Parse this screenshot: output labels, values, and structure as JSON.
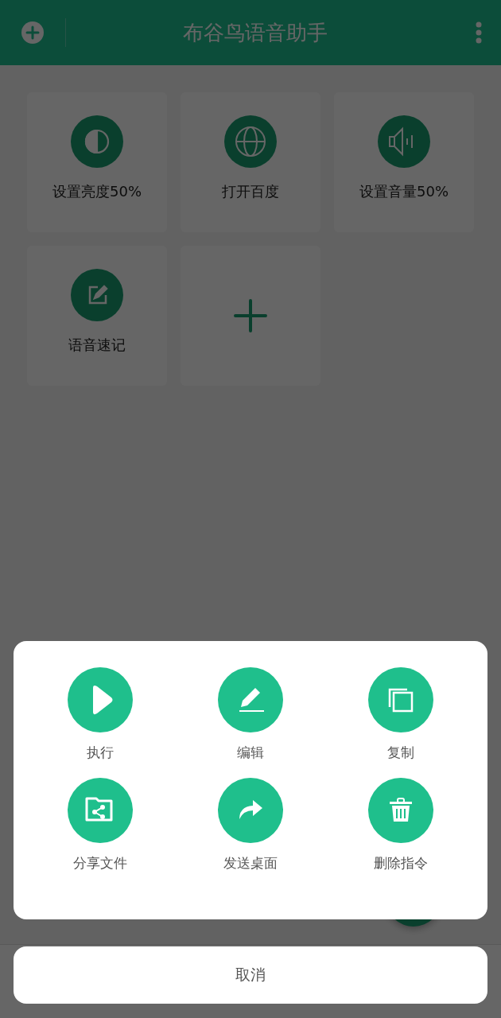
{
  "app_bar": {
    "title": "布谷鸟语音助手"
  },
  "commands": [
    {
      "kind": "command",
      "label": "设置亮度50%"
    },
    {
      "kind": "command",
      "label": "打开百度"
    },
    {
      "kind": "command",
      "label": "设置音量50%"
    },
    {
      "kind": "command",
      "label": "语音速记"
    },
    {
      "kind": "add"
    }
  ],
  "action_sheet": {
    "actions": [
      {
        "label": "执行"
      },
      {
        "label": "编辑"
      },
      {
        "label": "复制"
      },
      {
        "label": "分享文件"
      },
      {
        "label": "发送桌面"
      },
      {
        "label": "删除指令"
      }
    ],
    "cancel": "取消"
  }
}
